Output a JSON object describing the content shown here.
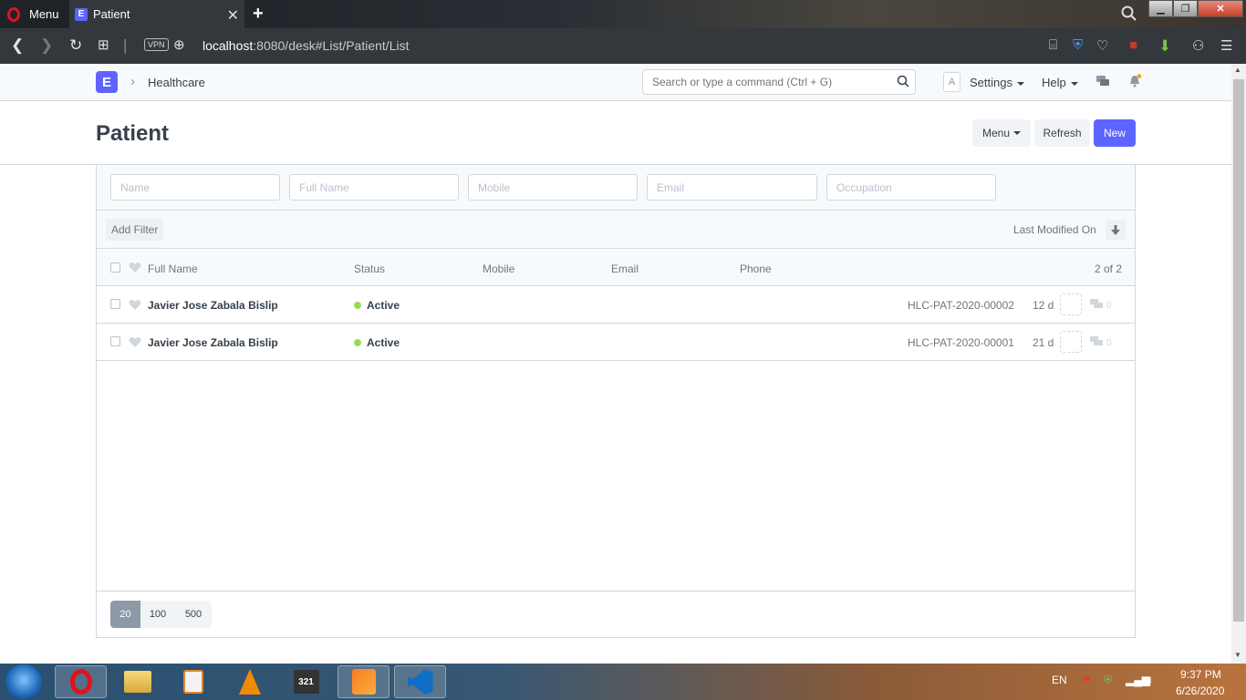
{
  "browser": {
    "menu_label": "Menu",
    "tab_title": "Patient",
    "tab_favicon_letter": "E",
    "url_host": "localhost",
    "url_rest": ":8080/desk#List/Patient/List",
    "vpn_label": "VPN"
  },
  "navbar": {
    "logo_letter": "E",
    "breadcrumb": "Healthcare",
    "search_placeholder": "Search or type a command (Ctrl + G)",
    "avatar_letter": "A",
    "settings_label": "Settings",
    "help_label": "Help"
  },
  "page": {
    "title": "Patient",
    "menu_button": "Menu",
    "refresh_button": "Refresh",
    "new_button": "New"
  },
  "filters": {
    "fields": [
      "Name",
      "Full Name",
      "Mobile",
      "Email",
      "Occupation"
    ],
    "add_filter": "Add Filter",
    "sort_label": "Last Modified On"
  },
  "list": {
    "columns": [
      "Full Name",
      "Status",
      "Mobile",
      "Email",
      "Phone"
    ],
    "count": "2 of 2",
    "rows": [
      {
        "full_name": "Javier Jose Zabala Bislip",
        "status": "Active",
        "docname": "HLC-PAT-2020-00002",
        "age": "12 d",
        "comments": "0"
      },
      {
        "full_name": "Javier Jose Zabala Bislip",
        "status": "Active",
        "docname": "HLC-PAT-2020-00001",
        "age": "21 d",
        "comments": "0"
      }
    ],
    "page_sizes": [
      "20",
      "100",
      "500"
    ],
    "active_page_size": "20"
  },
  "taskbar": {
    "language": "EN",
    "time": "9:37 PM",
    "date": "6/26/2020"
  },
  "colors": {
    "primary": "#5e64ff",
    "status_active": "#98d85b",
    "text": "#36414c",
    "muted": "#6c7680",
    "border": "#d1d8dd"
  }
}
